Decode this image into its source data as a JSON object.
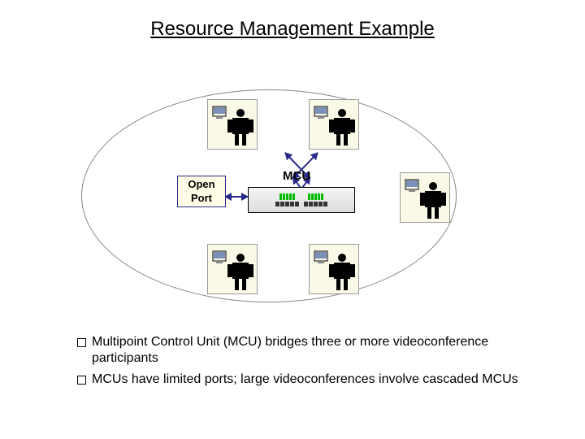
{
  "title": "Resource Management Example",
  "labels": {
    "mcu": "MCU",
    "open_port_line1": "Open",
    "open_port_line2": "Port"
  },
  "endpoints": [
    {
      "id": "top-left"
    },
    {
      "id": "top-right"
    },
    {
      "id": "right"
    },
    {
      "id": "bottom-left"
    },
    {
      "id": "bottom-right"
    }
  ],
  "bullets": [
    "Multipoint Control Unit (MCU) bridges three or more videoconference participants",
    "MCUs have limited ports; large videoconferences involve cascaded MCUs"
  ]
}
